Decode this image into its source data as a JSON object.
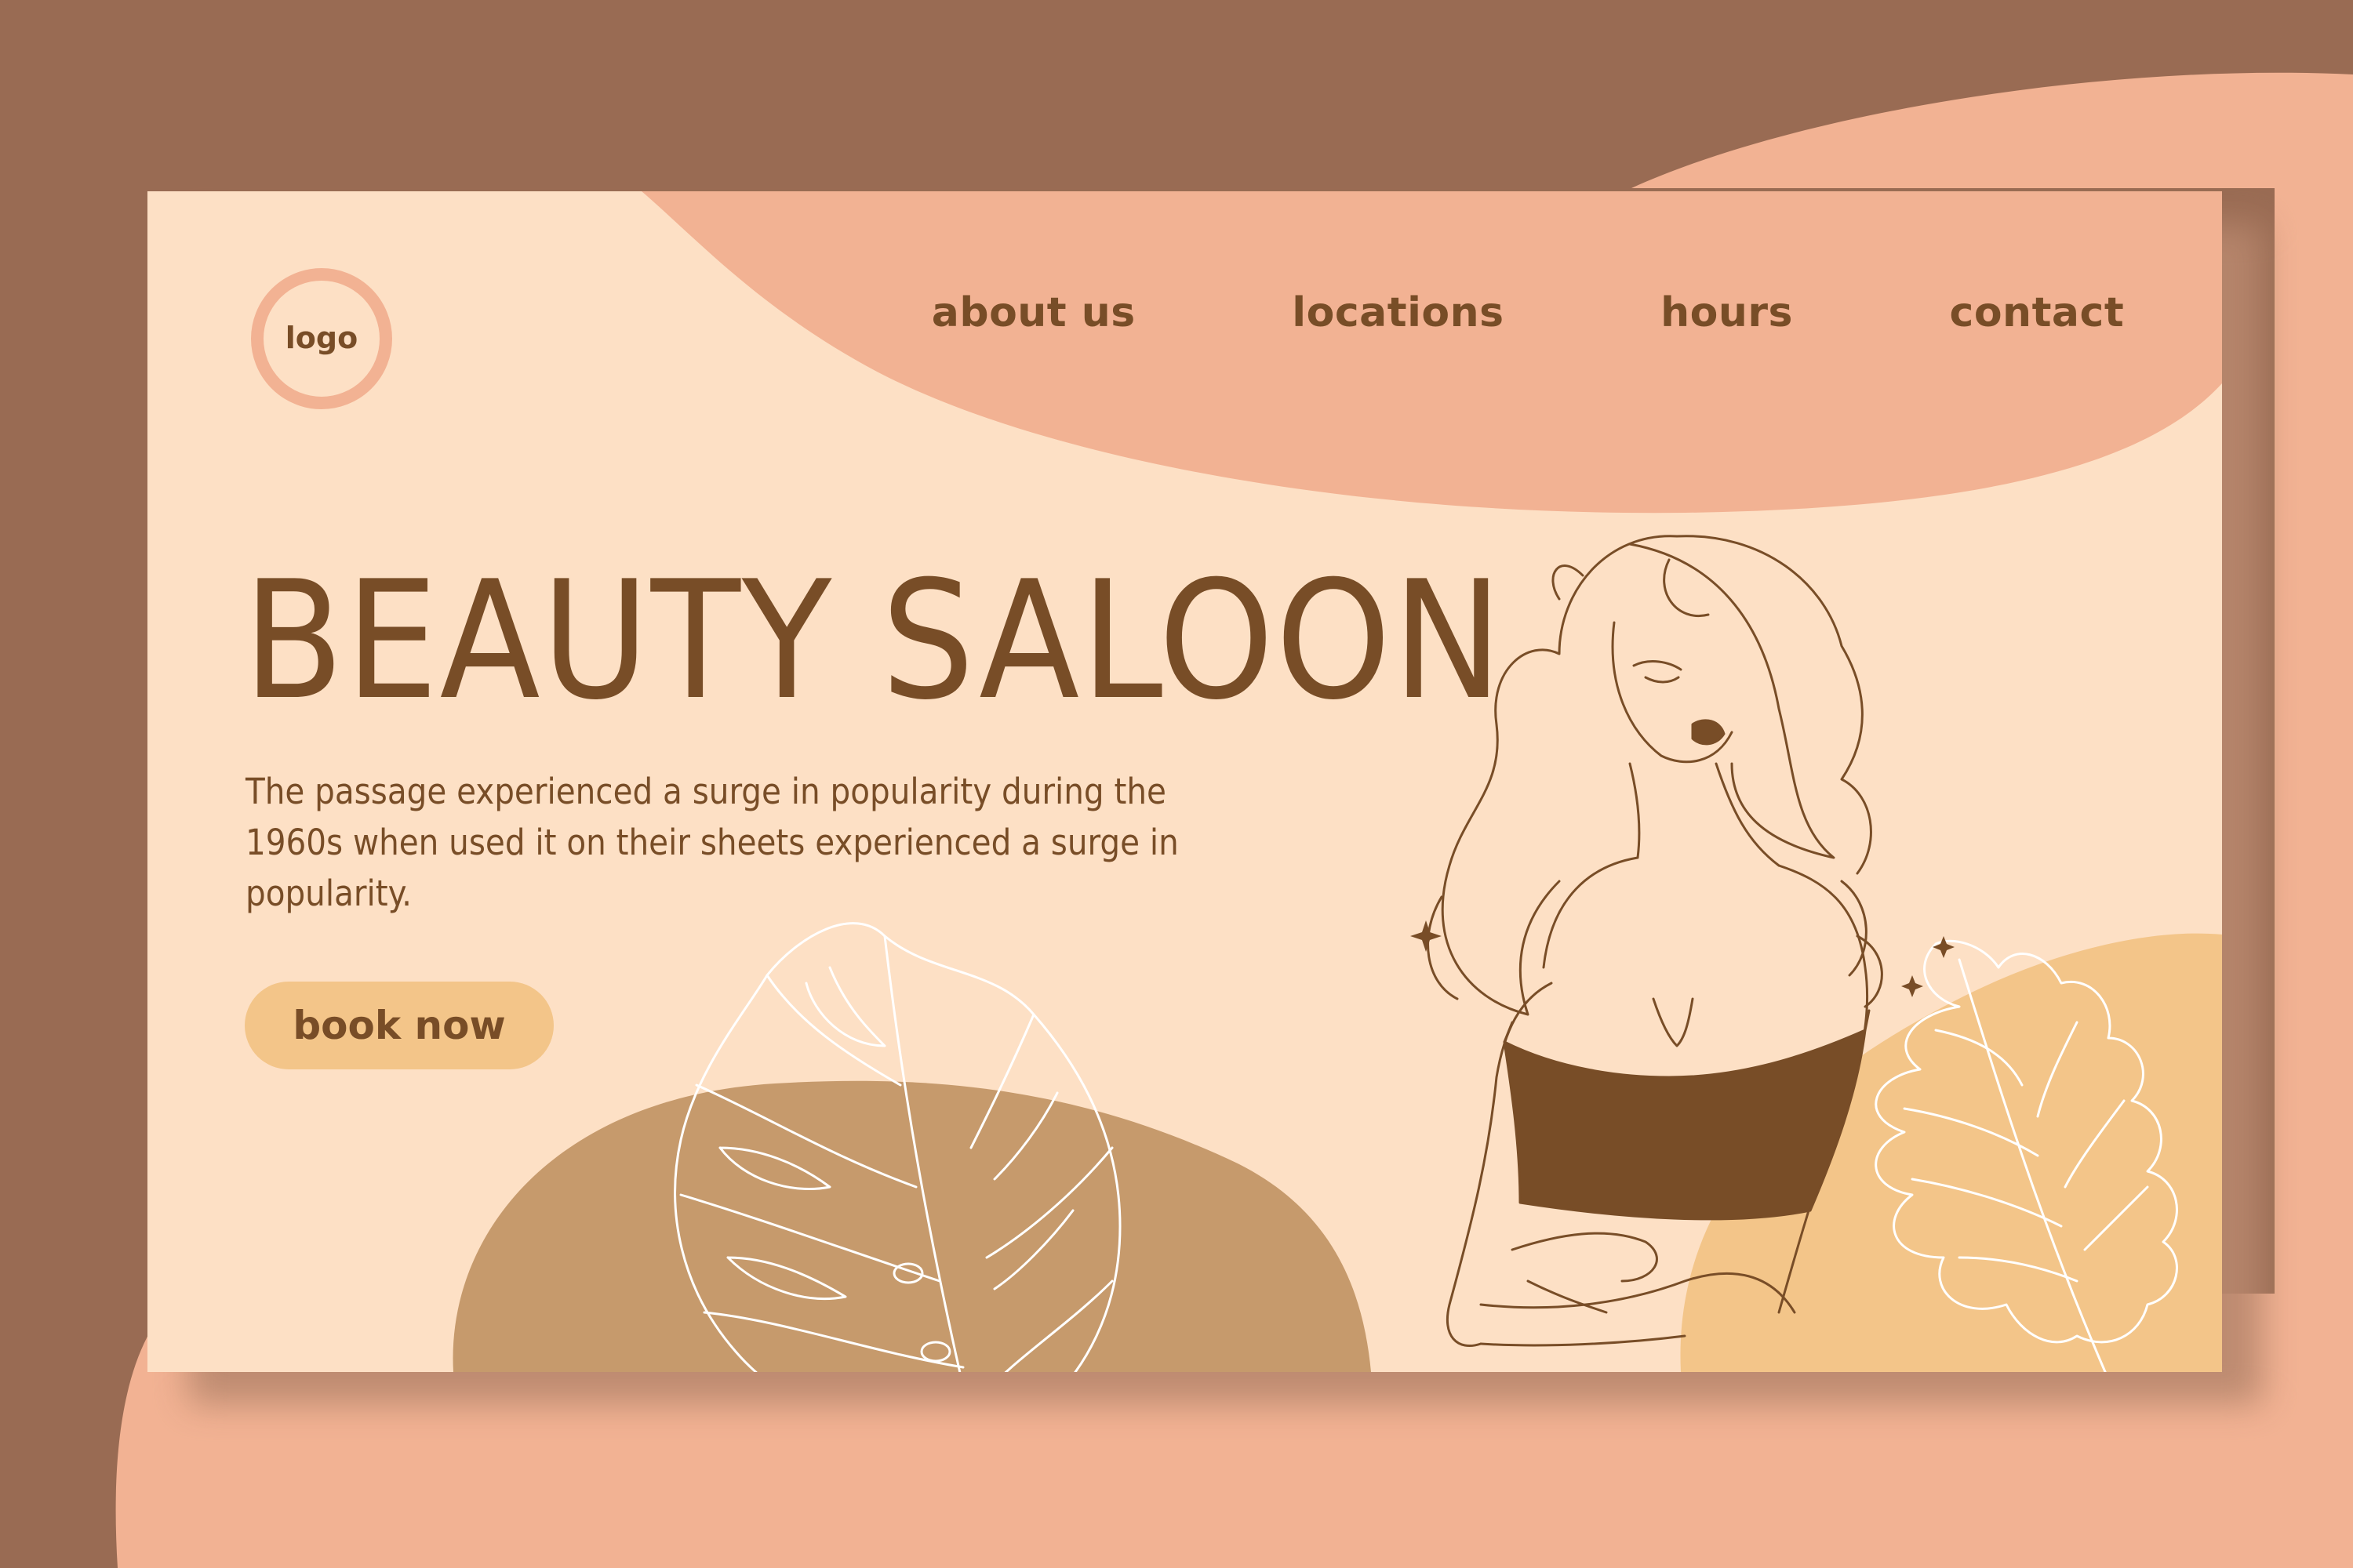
{
  "logo": {
    "text": "logo",
    "icon": "logo-ring-icon"
  },
  "nav": {
    "items": [
      {
        "label": "about us"
      },
      {
        "label": "locations"
      },
      {
        "label": "hours"
      },
      {
        "label": "contact"
      }
    ]
  },
  "hero": {
    "title": "BEAUTY SALOON",
    "description": "The passage experienced a surge in popularity during the 1960s when used it on their sheets experienced a surge in popularity.",
    "cta_label": "book now"
  },
  "illustrations": [
    "woman-portrait",
    "monstera-leaf",
    "oak-leaf"
  ],
  "colors": {
    "outer_background": "#996b53",
    "outer_accent": "#f2b293",
    "card_background": "#fde0c5",
    "header_wave": "#f2b293",
    "text_brown": "#784d27",
    "button_fill": "#f3c589",
    "blob_tan": "#c69a6c",
    "blob_yellow": "#f3c589",
    "leaf_line": "#ffffff"
  }
}
